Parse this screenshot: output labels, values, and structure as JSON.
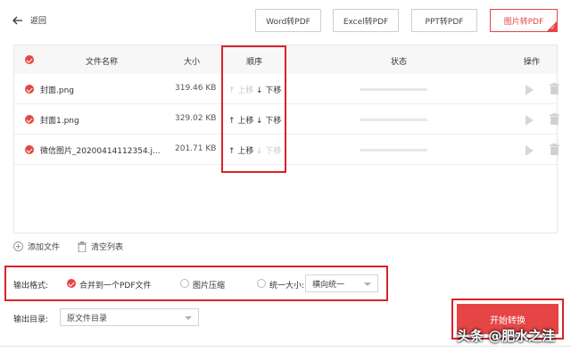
{
  "header": {
    "back_label": "返回",
    "tabs": [
      {
        "label": "Word转PDF",
        "active": false
      },
      {
        "label": "Excel转PDF",
        "active": false
      },
      {
        "label": "PPT转PDF",
        "active": false
      },
      {
        "label": "图片转PDF",
        "active": true
      }
    ]
  },
  "table": {
    "columns": {
      "name": "文件名称",
      "size": "大小",
      "order": "顺序",
      "status": "状态",
      "action": "操作"
    },
    "rows": [
      {
        "name": "封面.png",
        "size": "319.46 KB",
        "up": "上移",
        "down": "下移",
        "up_enabled": false,
        "down_enabled": true
      },
      {
        "name": "封面1.png",
        "size": "329.02 KB",
        "up": "上移",
        "down": "下移",
        "up_enabled": true,
        "down_enabled": true
      },
      {
        "name": "微信图片_20200414112354.j...",
        "size": "201.71 KB",
        "up": "上移",
        "down": "下移",
        "up_enabled": true,
        "down_enabled": false
      }
    ]
  },
  "actions": {
    "add_files": "添加文件",
    "clear_list": "清空列表"
  },
  "output_format": {
    "label": "输出格式:",
    "options": [
      {
        "label": "合并到一个PDF文件",
        "selected": true
      },
      {
        "label": "图片压缩",
        "selected": false
      },
      {
        "label": "统一大小:",
        "selected": false
      }
    ],
    "size_select_value": "横向统一"
  },
  "output_dir": {
    "label": "输出目录:",
    "value": "原文件目录"
  },
  "start_button": "开始转换",
  "watermark": "头条 @肥水之洼",
  "colors": {
    "accent": "#e54545",
    "highlight_box": "#d9232a"
  }
}
